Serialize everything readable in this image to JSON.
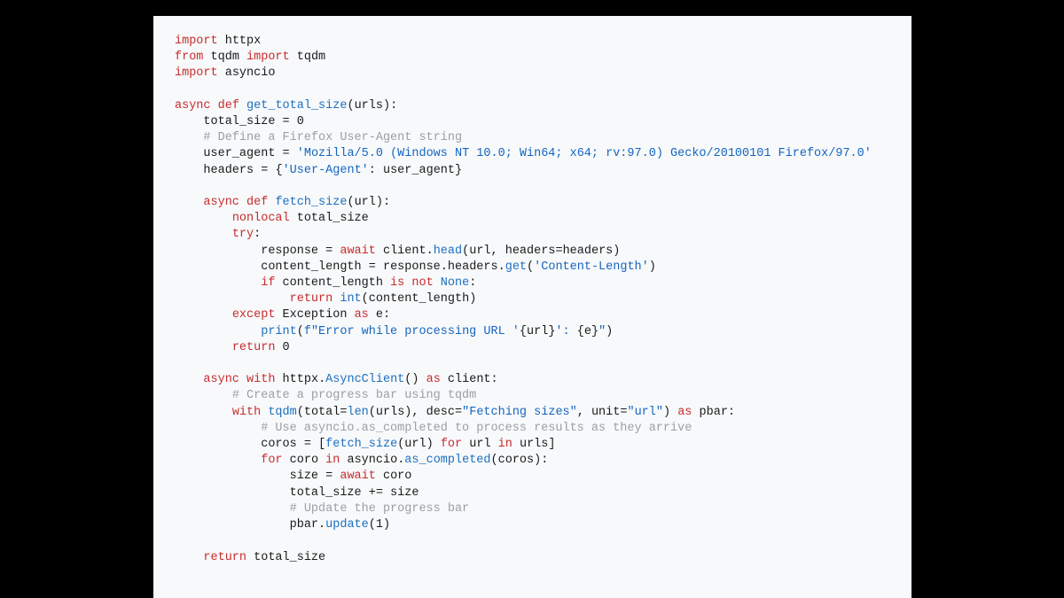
{
  "code": {
    "language": "python",
    "tokens": [
      [
        [
          "kw",
          "import"
        ],
        [
          "sp",
          " "
        ],
        [
          "name",
          "httpx"
        ]
      ],
      [
        [
          "kw",
          "from"
        ],
        [
          "sp",
          " "
        ],
        [
          "name",
          "tqdm"
        ],
        [
          "sp",
          " "
        ],
        [
          "kw",
          "import"
        ],
        [
          "sp",
          " "
        ],
        [
          "name",
          "tqdm"
        ]
      ],
      [
        [
          "kw",
          "import"
        ],
        [
          "sp",
          " "
        ],
        [
          "name",
          "asyncio"
        ]
      ],
      [],
      [
        [
          "kw",
          "async"
        ],
        [
          "sp",
          " "
        ],
        [
          "kw",
          "def"
        ],
        [
          "sp",
          " "
        ],
        [
          "fn",
          "get_total_size"
        ],
        [
          "op",
          "("
        ],
        [
          "name",
          "urls"
        ],
        [
          "op",
          "):"
        ]
      ],
      [
        [
          "sp",
          "    "
        ],
        [
          "name",
          "total_size"
        ],
        [
          "sp",
          " "
        ],
        [
          "op",
          "="
        ],
        [
          "sp",
          " "
        ],
        [
          "num",
          "0"
        ]
      ],
      [
        [
          "sp",
          "    "
        ],
        [
          "comment",
          "# Define a Firefox User-Agent string"
        ]
      ],
      [
        [
          "sp",
          "    "
        ],
        [
          "name",
          "user_agent"
        ],
        [
          "sp",
          " "
        ],
        [
          "op",
          "="
        ],
        [
          "sp",
          " "
        ],
        [
          "str2",
          "'Mozilla/5.0 (Windows NT 10.0; Win64; x64; rv:97.0) Gecko/20100101 Firefox/97.0'"
        ]
      ],
      [
        [
          "sp",
          "    "
        ],
        [
          "name",
          "headers"
        ],
        [
          "sp",
          " "
        ],
        [
          "op",
          "="
        ],
        [
          "sp",
          " "
        ],
        [
          "op",
          "{"
        ],
        [
          "str2",
          "'User-Agent'"
        ],
        [
          "op",
          ": "
        ],
        [
          "name",
          "user_agent"
        ],
        [
          "op",
          "}"
        ]
      ],
      [],
      [
        [
          "sp",
          "    "
        ],
        [
          "kw",
          "async"
        ],
        [
          "sp",
          " "
        ],
        [
          "kw",
          "def"
        ],
        [
          "sp",
          " "
        ],
        [
          "fn",
          "fetch_size"
        ],
        [
          "op",
          "("
        ],
        [
          "name",
          "url"
        ],
        [
          "op",
          "):"
        ]
      ],
      [
        [
          "sp",
          "        "
        ],
        [
          "kw",
          "nonlocal"
        ],
        [
          "sp",
          " "
        ],
        [
          "name",
          "total_size"
        ]
      ],
      [
        [
          "sp",
          "        "
        ],
        [
          "kw",
          "try"
        ],
        [
          "op",
          ":"
        ]
      ],
      [
        [
          "sp",
          "            "
        ],
        [
          "name",
          "response"
        ],
        [
          "sp",
          " "
        ],
        [
          "op",
          "="
        ],
        [
          "sp",
          " "
        ],
        [
          "kw",
          "await"
        ],
        [
          "sp",
          " "
        ],
        [
          "name",
          "client"
        ],
        [
          "op",
          "."
        ],
        [
          "call",
          "head"
        ],
        [
          "op",
          "("
        ],
        [
          "name",
          "url"
        ],
        [
          "op",
          ", "
        ],
        [
          "name",
          "headers"
        ],
        [
          "op",
          "="
        ],
        [
          "name",
          "headers"
        ],
        [
          "op",
          ")"
        ]
      ],
      [
        [
          "sp",
          "            "
        ],
        [
          "name",
          "content_length"
        ],
        [
          "sp",
          " "
        ],
        [
          "op",
          "="
        ],
        [
          "sp",
          " "
        ],
        [
          "name",
          "response"
        ],
        [
          "op",
          "."
        ],
        [
          "name",
          "headers"
        ],
        [
          "op",
          "."
        ],
        [
          "call",
          "get"
        ],
        [
          "op",
          "("
        ],
        [
          "str2",
          "'Content-Length'"
        ],
        [
          "op",
          ")"
        ]
      ],
      [
        [
          "sp",
          "            "
        ],
        [
          "kw",
          "if"
        ],
        [
          "sp",
          " "
        ],
        [
          "name",
          "content_length"
        ],
        [
          "sp",
          " "
        ],
        [
          "kw",
          "is"
        ],
        [
          "sp",
          " "
        ],
        [
          "kw",
          "not"
        ],
        [
          "sp",
          " "
        ],
        [
          "builtin",
          "None"
        ],
        [
          "op",
          ":"
        ]
      ],
      [
        [
          "sp",
          "                "
        ],
        [
          "kw",
          "return"
        ],
        [
          "sp",
          " "
        ],
        [
          "builtin",
          "int"
        ],
        [
          "op",
          "("
        ],
        [
          "name",
          "content_length"
        ],
        [
          "op",
          ")"
        ]
      ],
      [
        [
          "sp",
          "        "
        ],
        [
          "kw",
          "except"
        ],
        [
          "sp",
          " "
        ],
        [
          "name",
          "Exception"
        ],
        [
          "sp",
          " "
        ],
        [
          "kw",
          "as"
        ],
        [
          "sp",
          " "
        ],
        [
          "name",
          "e"
        ],
        [
          "op",
          ":"
        ]
      ],
      [
        [
          "sp",
          "            "
        ],
        [
          "call",
          "print"
        ],
        [
          "op",
          "("
        ],
        [
          "str2",
          "f\"Error while processing URL '"
        ],
        [
          "op",
          "{"
        ],
        [
          "name",
          "url"
        ],
        [
          "op",
          "}"
        ],
        [
          "str2",
          "': "
        ],
        [
          "op",
          "{"
        ],
        [
          "name",
          "e"
        ],
        [
          "op",
          "}"
        ],
        [
          "str2",
          "\""
        ],
        [
          "op",
          ")"
        ]
      ],
      [
        [
          "sp",
          "        "
        ],
        [
          "kw",
          "return"
        ],
        [
          "sp",
          " "
        ],
        [
          "num",
          "0"
        ]
      ],
      [],
      [
        [
          "sp",
          "    "
        ],
        [
          "kw",
          "async"
        ],
        [
          "sp",
          " "
        ],
        [
          "kw",
          "with"
        ],
        [
          "sp",
          " "
        ],
        [
          "name",
          "httpx"
        ],
        [
          "op",
          "."
        ],
        [
          "call",
          "AsyncClient"
        ],
        [
          "op",
          "()"
        ],
        [
          "sp",
          " "
        ],
        [
          "kw",
          "as"
        ],
        [
          "sp",
          " "
        ],
        [
          "name",
          "client"
        ],
        [
          "op",
          ":"
        ]
      ],
      [
        [
          "sp",
          "        "
        ],
        [
          "comment",
          "# Create a progress bar using tqdm"
        ]
      ],
      [
        [
          "sp",
          "        "
        ],
        [
          "kw",
          "with"
        ],
        [
          "sp",
          " "
        ],
        [
          "call",
          "tqdm"
        ],
        [
          "op",
          "("
        ],
        [
          "name",
          "total"
        ],
        [
          "op",
          "="
        ],
        [
          "call",
          "len"
        ],
        [
          "op",
          "("
        ],
        [
          "name",
          "urls"
        ],
        [
          "op",
          "), "
        ],
        [
          "name",
          "desc"
        ],
        [
          "op",
          "="
        ],
        [
          "str2",
          "\"Fetching sizes\""
        ],
        [
          "op",
          ", "
        ],
        [
          "name",
          "unit"
        ],
        [
          "op",
          "="
        ],
        [
          "str2",
          "\"url\""
        ],
        [
          "op",
          ")"
        ],
        [
          "sp",
          " "
        ],
        [
          "kw",
          "as"
        ],
        [
          "sp",
          " "
        ],
        [
          "name",
          "pbar"
        ],
        [
          "op",
          ":"
        ]
      ],
      [
        [
          "sp",
          "            "
        ],
        [
          "comment",
          "# Use asyncio.as_completed to process results as they arrive"
        ]
      ],
      [
        [
          "sp",
          "            "
        ],
        [
          "name",
          "coros"
        ],
        [
          "sp",
          " "
        ],
        [
          "op",
          "="
        ],
        [
          "sp",
          " "
        ],
        [
          "op",
          "["
        ],
        [
          "call",
          "fetch_size"
        ],
        [
          "op",
          "("
        ],
        [
          "name",
          "url"
        ],
        [
          "op",
          ")"
        ],
        [
          "sp",
          " "
        ],
        [
          "kw",
          "for"
        ],
        [
          "sp",
          " "
        ],
        [
          "name",
          "url"
        ],
        [
          "sp",
          " "
        ],
        [
          "kw",
          "in"
        ],
        [
          "sp",
          " "
        ],
        [
          "name",
          "urls"
        ],
        [
          "op",
          "]"
        ]
      ],
      [
        [
          "sp",
          "            "
        ],
        [
          "kw",
          "for"
        ],
        [
          "sp",
          " "
        ],
        [
          "name",
          "coro"
        ],
        [
          "sp",
          " "
        ],
        [
          "kw",
          "in"
        ],
        [
          "sp",
          " "
        ],
        [
          "name",
          "asyncio"
        ],
        [
          "op",
          "."
        ],
        [
          "call",
          "as_completed"
        ],
        [
          "op",
          "("
        ],
        [
          "name",
          "coros"
        ],
        [
          "op",
          "):"
        ]
      ],
      [
        [
          "sp",
          "                "
        ],
        [
          "name",
          "size"
        ],
        [
          "sp",
          " "
        ],
        [
          "op",
          "="
        ],
        [
          "sp",
          " "
        ],
        [
          "kw",
          "await"
        ],
        [
          "sp",
          " "
        ],
        [
          "name",
          "coro"
        ]
      ],
      [
        [
          "sp",
          "                "
        ],
        [
          "name",
          "total_size"
        ],
        [
          "sp",
          " "
        ],
        [
          "op",
          "+="
        ],
        [
          "sp",
          " "
        ],
        [
          "name",
          "size"
        ]
      ],
      [
        [
          "sp",
          "                "
        ],
        [
          "comment",
          "# Update the progress bar"
        ]
      ],
      [
        [
          "sp",
          "                "
        ],
        [
          "name",
          "pbar"
        ],
        [
          "op",
          "."
        ],
        [
          "call",
          "update"
        ],
        [
          "op",
          "("
        ],
        [
          "num",
          "1"
        ],
        [
          "op",
          ")"
        ]
      ],
      [],
      [
        [
          "sp",
          "    "
        ],
        [
          "kw",
          "return"
        ],
        [
          "sp",
          " "
        ],
        [
          "name",
          "total_size"
        ]
      ]
    ]
  }
}
